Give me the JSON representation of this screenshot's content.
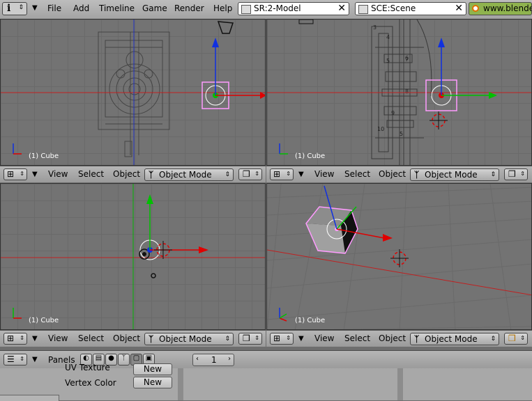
{
  "menubar": {
    "items": [
      "File",
      "Add",
      "Timeline",
      "Game",
      "Render",
      "Help"
    ],
    "screen_select": "SR:2-Model",
    "scene_select": "SCE:Scene",
    "url": "www.blende"
  },
  "viewports": [
    {
      "label": "(1) Cube",
      "header": {
        "view": "View",
        "select": "Select",
        "object": "Object",
        "mode": "Object Mode"
      }
    },
    {
      "label": "(1) Cube",
      "header": {
        "view": "View",
        "select": "Select",
        "object": "Object",
        "mode": "Object Mode"
      }
    },
    {
      "label": "(1) Cube",
      "header": {
        "view": "View",
        "select": "Select",
        "object": "Object",
        "mode": "Object Mode"
      }
    },
    {
      "label": "(1) Cube",
      "header": {
        "view": "View",
        "select": "Select",
        "object": "Object",
        "mode": "Object Mode"
      }
    }
  ],
  "buttons_window": {
    "panels_label": "Panels",
    "frame_value": "1",
    "uv_texture_label": "UV Texture",
    "uv_texture_btn": "New",
    "vertex_color_label": "Vertex Color",
    "vertex_color_btn": "New"
  },
  "colors": {
    "x_axis": "#e00000",
    "y_axis": "#00c000",
    "z_axis": "#1030e0",
    "selection": "#ff9bff"
  }
}
